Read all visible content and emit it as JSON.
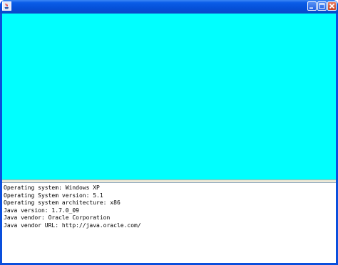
{
  "window": {
    "title": "",
    "icon": "java-app-icon",
    "controls": {
      "minimize_icon": "minimize-icon",
      "maximize_icon": "maximize-icon",
      "close_icon": "close-icon"
    }
  },
  "canvas": {
    "color": "#00ffff"
  },
  "info": {
    "lines": [
      "Operating system: Windows XP",
      "Operating System version: 5.1",
      "Operating system architecture: x86",
      "Java version: 1.7.0_09",
      "Java vendor: Oracle Corporation",
      "Java vendor URL: http://java.oracle.com/"
    ]
  }
}
